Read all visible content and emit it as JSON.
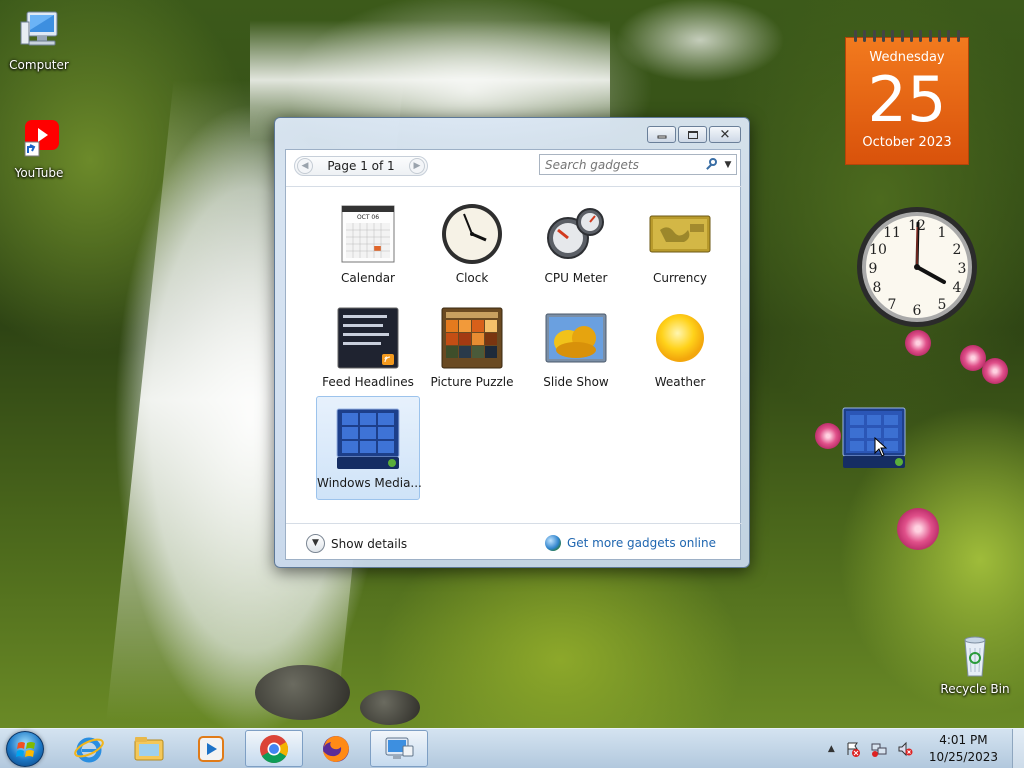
{
  "desktop": {
    "icons": [
      {
        "label": "Computer"
      },
      {
        "label": "YouTube"
      },
      {
        "label": "Recycle Bin"
      }
    ]
  },
  "gadget_window": {
    "pager": {
      "label": "Page 1 of 1"
    },
    "search": {
      "placeholder": "Search gadgets"
    },
    "gadgets": [
      {
        "label": "Calendar",
        "icon": "calendar-icon"
      },
      {
        "label": "Clock",
        "icon": "clock-icon"
      },
      {
        "label": "CPU Meter",
        "icon": "cpu-meter-icon"
      },
      {
        "label": "Currency",
        "icon": "currency-icon"
      },
      {
        "label": "Feed Headlines",
        "icon": "feed-headlines-icon"
      },
      {
        "label": "Picture Puzzle",
        "icon": "picture-puzzle-icon"
      },
      {
        "label": "Slide Show",
        "icon": "slide-show-icon"
      },
      {
        "label": "Weather",
        "icon": "weather-icon"
      },
      {
        "label": "Windows Media...",
        "icon": "windows-media-center-icon"
      }
    ],
    "show_details": "Show details",
    "get_more": "Get more gadgets online"
  },
  "calendar_gadget": {
    "weekday": "Wednesday",
    "day": "25",
    "month_year": "October 2023",
    "mini_month": "OCT 06"
  },
  "clock_gadget": {
    "time_shown": "4:01"
  },
  "taskbar": {
    "time": "4:01 PM",
    "date": "10/25/2023",
    "pinned": [
      "internet-explorer-icon",
      "file-explorer-icon",
      "media-player-icon",
      "chrome-icon",
      "firefox-icon",
      "gadgets-icon"
    ]
  },
  "colors": {
    "calendar_orange": "#e8650f",
    "link_blue": "#1f66b0",
    "selected_tile": "#cfe3f8"
  }
}
